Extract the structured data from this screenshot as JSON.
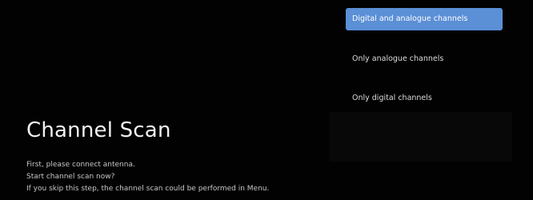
{
  "screen": {
    "title": "Channel Scan",
    "description_lines": [
      "First, please connect antenna.",
      "Start channel scan now?",
      "If you skip this step, the channel scan could be performed in Menu."
    ]
  },
  "scan_options": {
    "selected_index": 0,
    "items": [
      {
        "label": "Digital and analogue channels"
      },
      {
        "label": "Only analogue channels"
      },
      {
        "label": "Only digital channels"
      }
    ]
  },
  "colors": {
    "background": "#020202",
    "selection": "#5b8fd6",
    "text": "#e6e6e6"
  }
}
